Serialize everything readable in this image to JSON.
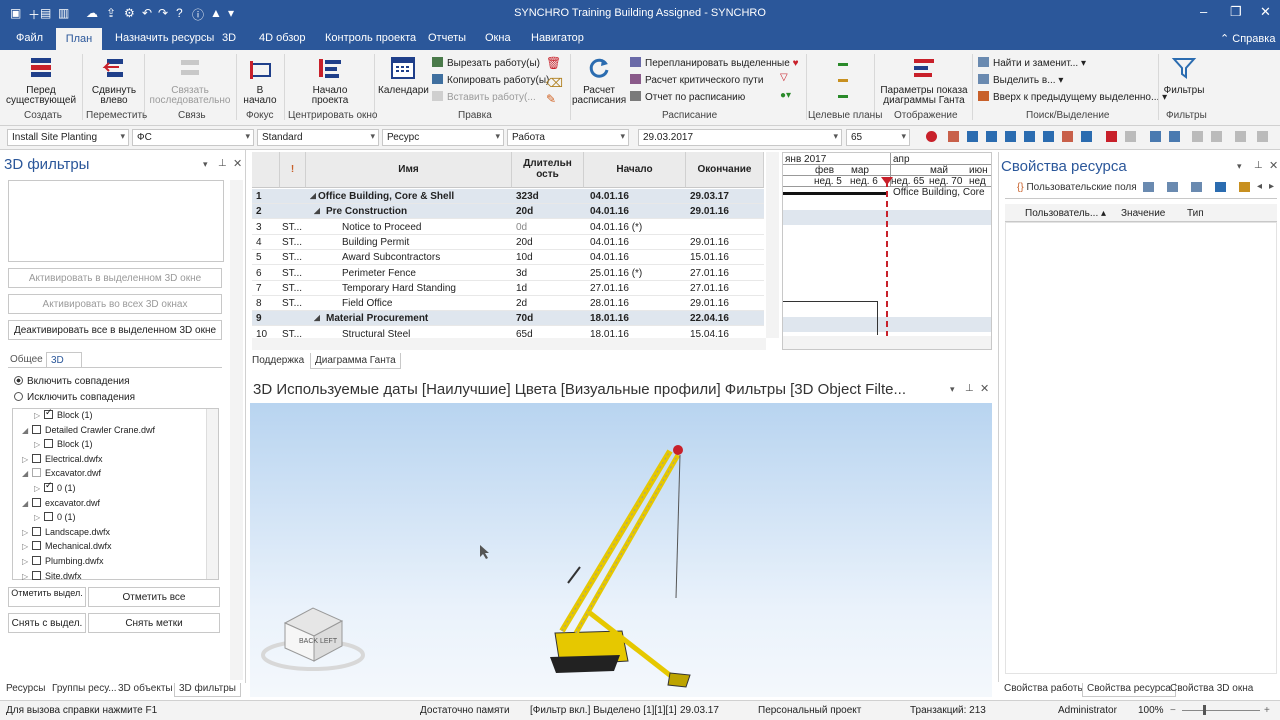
{
  "window": {
    "title": "SYNCHRO Training Building Assigned - SYNCHRO"
  },
  "menu": {
    "items": [
      "Файл",
      "План",
      "Назначить ресурсы",
      "3D",
      "4D обзор",
      "Контроль проекта",
      "Отчеты",
      "Окна",
      "Навигатор"
    ],
    "help": "Справка"
  },
  "ribbon": {
    "btn_before": "Перед существующей",
    "btn_shift": "Сдвинуть влево",
    "btn_link": "Связать последовательно",
    "btn_start": "В начало",
    "btn_project_start": "Начало проекта",
    "btn_calendars": "Календари",
    "cut": "Вырезать работу(ы)",
    "copy": "Копировать работу(ы)",
    "paste": "Вставить работу(...",
    "btn_calc": "Расчет расписания",
    "replan": "Перепланировать выделенные",
    "critical": "Расчет критического пути",
    "report": "Отчет по расписанию",
    "btn_gantt_params": "Параметры показа диаграммы Ганта",
    "find": "Найти и заменит...",
    "select": "Выделить в...",
    "prev_sel": "Вверх к предыдущему выделенно...",
    "btn_filters": "Фильтры",
    "groups": [
      "Создать",
      "Переместить",
      "Связь",
      "Фокус",
      "Центрировать окно",
      "Правка",
      "Расписание",
      "Целевые планы",
      "Отображение",
      "Поиск/Выделение",
      "Фильтры"
    ]
  },
  "toolbar": {
    "task": "Install Site Planting",
    "code": "ФС",
    "standard": "Standard",
    "resource": "Ресурс",
    "work": "Работа",
    "date": "29.03.2017",
    "zoom": "65"
  },
  "left_panel": {
    "title": "3D фильтры",
    "btn_activate_sel": "Активировать в выделенном 3D окне",
    "btn_activate_all": "Активировать во всех 3D окнах",
    "btn_deactivate": "Деактивировать все в выделенном 3D окне",
    "tab_general": "Общее",
    "tab_3d": "3D",
    "radio_include": "Включить совпадения",
    "radio_exclude": "Исключить совпадения",
    "tree": [
      {
        "label": "Block (1)",
        "checked": true,
        "level": 2
      },
      {
        "label": "Detailed Crawler Crane.dwf",
        "checked": false,
        "level": 1
      },
      {
        "label": "Block (1)",
        "checked": false,
        "level": 2
      },
      {
        "label": "Electrical.dwfx",
        "checked": false,
        "level": 1
      },
      {
        "label": "Excavator.dwf",
        "checked": false,
        "level": 1
      },
      {
        "label": "0 (1)",
        "checked": true,
        "level": 2
      },
      {
        "label": "excavator.dwf",
        "checked": false,
        "level": 1
      },
      {
        "label": "0 (1)",
        "checked": false,
        "level": 2
      },
      {
        "label": "Landscape.dwfx",
        "checked": false,
        "level": 1
      },
      {
        "label": "Mechanical.dwfx",
        "checked": false,
        "level": 1
      },
      {
        "label": "Plumbing.dwfx",
        "checked": false,
        "level": 1
      },
      {
        "label": "Site.dwfx",
        "checked": false,
        "level": 1
      }
    ],
    "btn_mark_sel": "Отметить выдел.",
    "btn_mark_all": "Отметить все",
    "btn_unmark_sel": "Снять с выдел.",
    "btn_unmark": "Снять метки",
    "bottom_tabs": [
      "Ресурсы",
      "Группы ресу...",
      "3D объекты",
      "3D фильтры"
    ]
  },
  "gantt": {
    "headers": {
      "name": "Имя",
      "duration": "Длительн ость",
      "start": "Начало",
      "end": "Окончание"
    },
    "rows": [
      {
        "n": "1",
        "code": "",
        "name": "Office Building, Core & Shell",
        "dur": "323d",
        "start": "04.01.16",
        "end": "29.03.17",
        "sum": true,
        "lvl": 0
      },
      {
        "n": "2",
        "code": "",
        "name": "Pre Construction",
        "dur": "20d",
        "start": "04.01.16",
        "end": "29.01.16",
        "sum": true,
        "lvl": 1
      },
      {
        "n": "3",
        "code": "ST...",
        "name": "Notice to Proceed",
        "dur": "0d",
        "start": "04.01.16 (*)",
        "end": "",
        "sum": false,
        "lvl": 2
      },
      {
        "n": "4",
        "code": "ST...",
        "name": "Building Permit",
        "dur": "20d",
        "start": "04.01.16",
        "end": "29.01.16",
        "sum": false,
        "lvl": 2
      },
      {
        "n": "5",
        "code": "ST...",
        "name": "Award Subcontractors",
        "dur": "10d",
        "start": "04.01.16",
        "end": "15.01.16",
        "sum": false,
        "lvl": 2
      },
      {
        "n": "6",
        "code": "ST...",
        "name": "Perimeter Fence",
        "dur": "3d",
        "start": "25.01.16 (*)",
        "end": "27.01.16",
        "sum": false,
        "lvl": 2
      },
      {
        "n": "7",
        "code": "ST...",
        "name": "Temporary Hard Standing",
        "dur": "1d",
        "start": "27.01.16",
        "end": "27.01.16",
        "sum": false,
        "lvl": 2
      },
      {
        "n": "8",
        "code": "ST...",
        "name": "Field Office",
        "dur": "2d",
        "start": "28.01.16",
        "end": "29.01.16",
        "sum": false,
        "lvl": 2
      },
      {
        "n": "9",
        "code": "",
        "name": "Material Procurement",
        "dur": "70d",
        "start": "18.01.16",
        "end": "22.04.16",
        "sum": true,
        "lvl": 1
      },
      {
        "n": "10",
        "code": "ST...",
        "name": "Structural Steel",
        "dur": "65d",
        "start": "18.01.16",
        "end": "15.04.16",
        "sum": false,
        "lvl": 2
      }
    ],
    "tabs": [
      "Поддержка",
      "Диаграмма Ганта"
    ]
  },
  "chart": {
    "months": [
      "янв 2017",
      "апр"
    ],
    "submonths": [
      "фев",
      "мар",
      "май",
      "июн"
    ],
    "weeks": [
      "нед. 5",
      "нед. 6",
      "нед. 65",
      "нед. 70",
      "нед"
    ],
    "bar_label": "Office Building, Core"
  },
  "view3d": {
    "title": "3D Используемые даты [Наилучшие] Цвета [Визуальные профили] Фильтры [3D Object Filte...",
    "cube_back": "BACK",
    "cube_left": "LEFT"
  },
  "props": {
    "title": "Свойства ресурса",
    "tab_label": "Пользовательские поля",
    "cols": [
      "Пользователь...",
      "Значение",
      "Тип"
    ],
    "bottom_tabs": [
      "Свойства работы",
      "Свойства ресурса",
      "Свойства 3D окна"
    ]
  },
  "status": {
    "help": "Для вызова справки нажмите F1",
    "memory": "Достаточно памяти",
    "filter": "[Фильтр вкл.] Выделено [1][1][1]",
    "date": "29.03.17",
    "project": "Персональный проект",
    "transactions": "Транзакций: 213",
    "user": "Administrator",
    "zoom": "100%"
  }
}
